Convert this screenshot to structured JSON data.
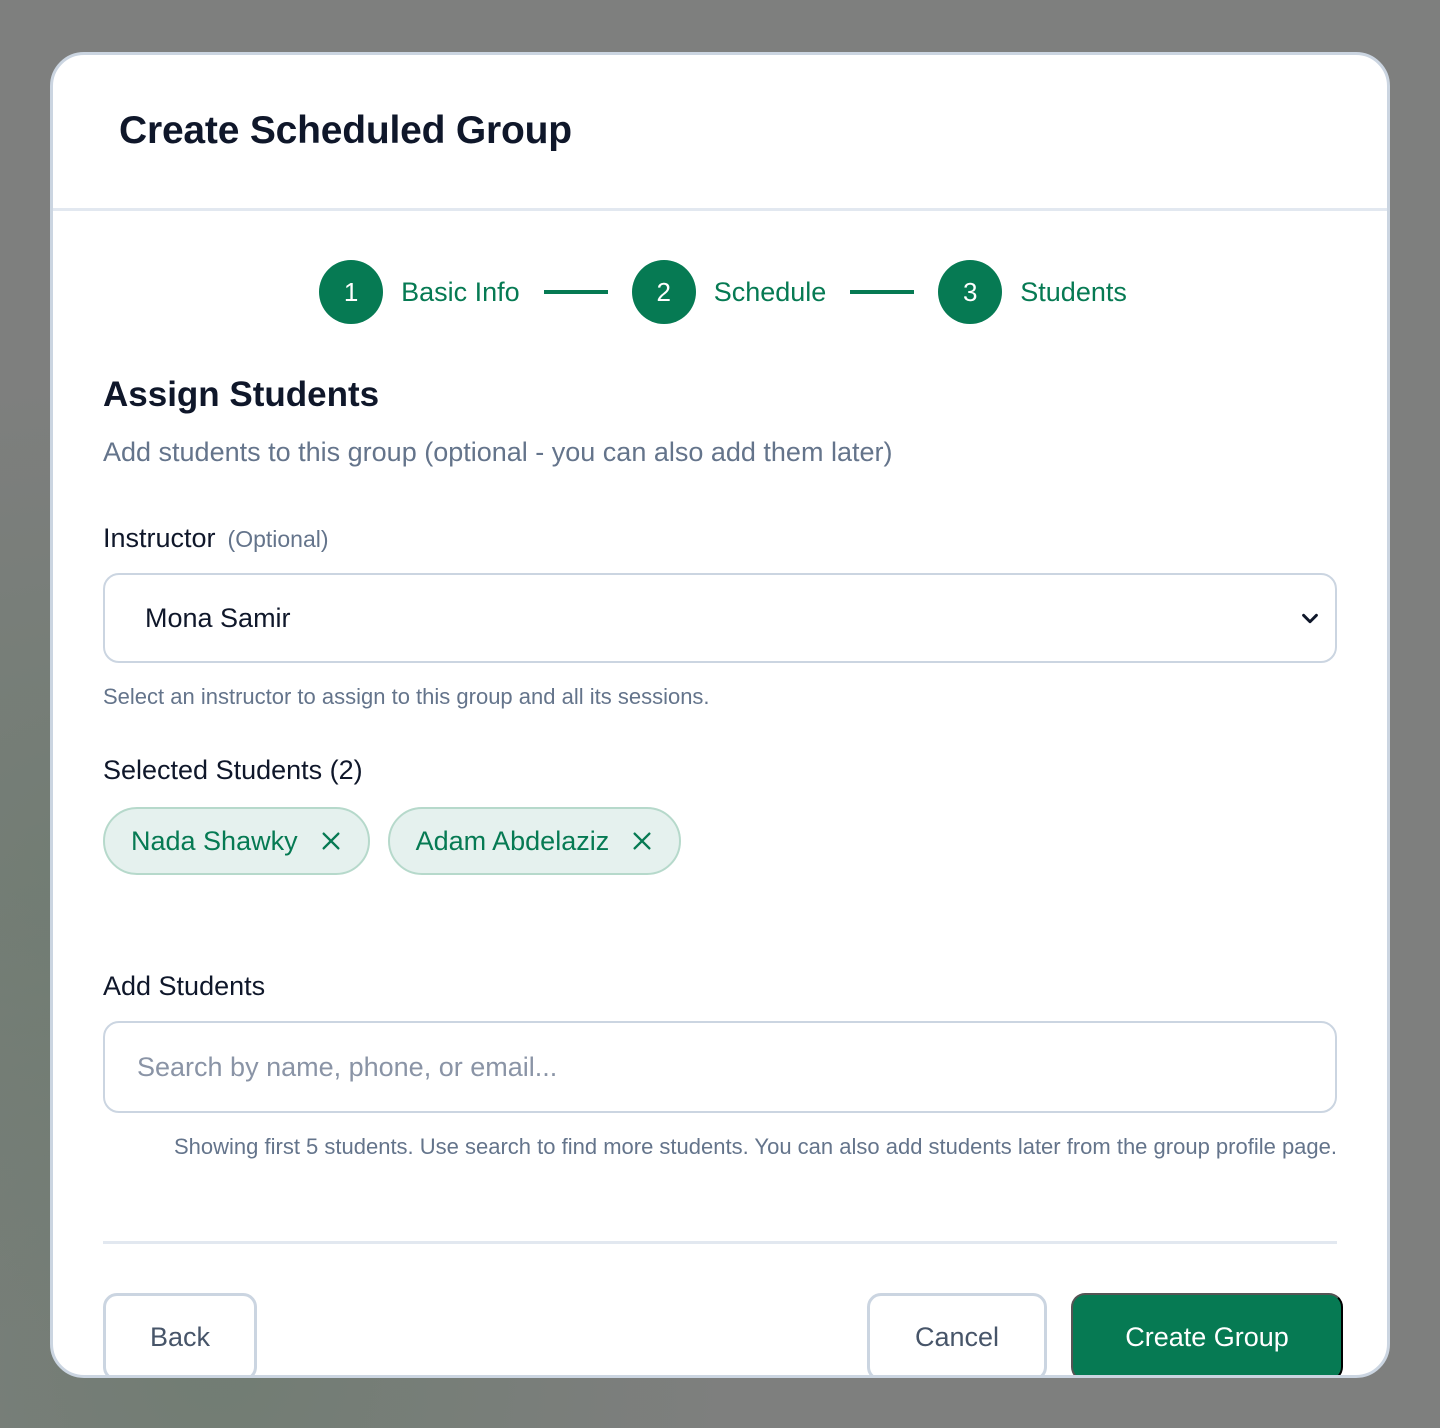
{
  "modal": {
    "title": "Create Scheduled Group"
  },
  "stepper": {
    "steps": [
      {
        "number": "1",
        "label": "Basic Info"
      },
      {
        "number": "2",
        "label": "Schedule"
      },
      {
        "number": "3",
        "label": "Students"
      }
    ]
  },
  "section": {
    "title": "Assign Students",
    "subtitle": "Add students to this group (optional - you can also add them later)"
  },
  "instructor": {
    "label": "Instructor",
    "optional_tag": "(Optional)",
    "selected_value": "Mona Samir",
    "help_text": "Select an instructor to assign to this group and all its sessions."
  },
  "selected_students": {
    "label": "Selected Students (2)",
    "chips": [
      {
        "name": "Nada Shawky"
      },
      {
        "name": "Adam Abdelaziz"
      }
    ]
  },
  "add_students": {
    "label": "Add Students",
    "search_placeholder": "Search by name, phone, or email...",
    "search_value": "",
    "help_text": "Showing first 5 students. Use search to find more students. You can also add students later from the group profile page."
  },
  "footer": {
    "back_label": "Back",
    "cancel_label": "Cancel",
    "create_label": "Create Group"
  },
  "colors": {
    "accent": "#067a53",
    "chip_background": "#e5f1ee",
    "border": "#cbd5e1",
    "muted_text": "#64748b"
  },
  "icons": {
    "dropdown": "chevron-down-icon",
    "remove_chip": "close-icon"
  }
}
